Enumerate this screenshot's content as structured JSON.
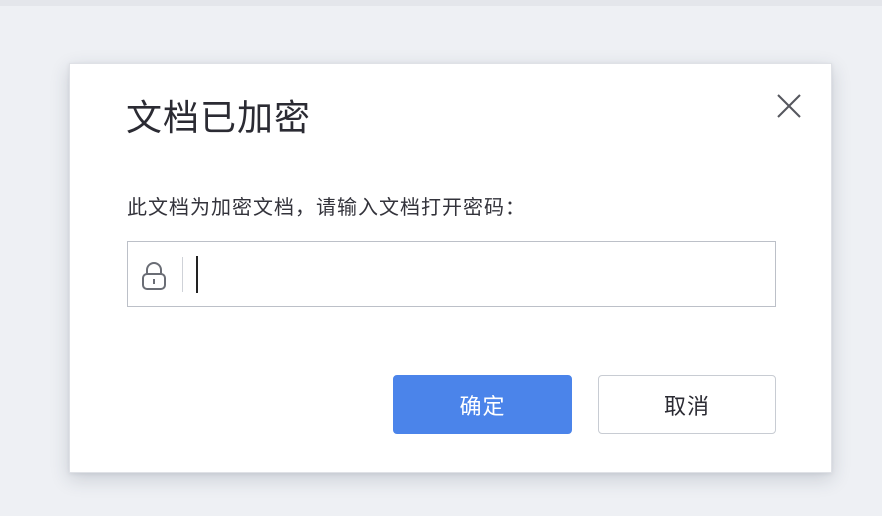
{
  "dialog": {
    "title": "文档已加密",
    "prompt": "此文档为加密文档，请输入文档打开密码：",
    "password_field": {
      "value": "",
      "lock_icon": "lock-icon"
    },
    "buttons": {
      "confirm_label": "确定",
      "cancel_label": "取消"
    },
    "close_icon": "close-icon"
  },
  "colors": {
    "primary": "#4b84ea",
    "text": "#2b2b33",
    "border": "#bcc0c8"
  }
}
